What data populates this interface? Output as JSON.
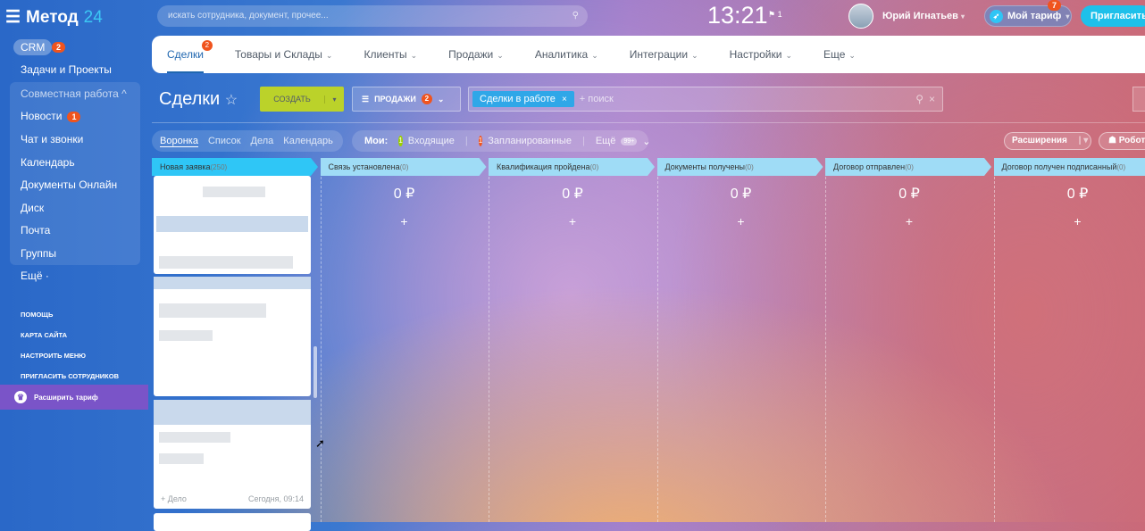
{
  "app": {
    "logo_name": "Метод",
    "logo_num": "24"
  },
  "sidebar": {
    "crm": "CRM",
    "crm_badge": "2",
    "tasks": "Задачи и Проекты",
    "group": "Совместная работа ^",
    "news": "Новости",
    "news_badge": "1",
    "chat": "Чат и звонки",
    "calendar": "Календарь",
    "docs": "Документы Онлайн",
    "disk": "Диск",
    "mail": "Почта",
    "groups": "Группы",
    "more": "Ещё ·",
    "help": "Помощь",
    "sitemap": "Карта сайта",
    "setup_menu": "Настроить меню",
    "invite_staff": "Пригласить сотрудников",
    "upgrade": "Расширить тариф"
  },
  "header": {
    "search_placeholder": "искать сотрудника, документ, прочее...",
    "time": "13:21",
    "flag_count": "1",
    "user": "Юрий Игнатьев",
    "tariff": "Мой тариф",
    "tariff_badge": "7",
    "invite": "Пригласить"
  },
  "menu": {
    "items": [
      {
        "label": "Сделки",
        "badge": "2"
      },
      {
        "label": "Товары и Склады"
      },
      {
        "label": "Клиенты"
      },
      {
        "label": "Продажи"
      },
      {
        "label": "Аналитика"
      },
      {
        "label": "Интеграции"
      },
      {
        "label": "Настройки"
      },
      {
        "label": "Еще"
      }
    ]
  },
  "toolbar": {
    "title": "Сделки",
    "create": "СОЗДАТЬ",
    "sales": "ПРОДАЖИ",
    "sales_badge": "2",
    "filter_chip": "Сделки в работе",
    "filter_placeholder": "+ поиск"
  },
  "views": {
    "tabs": [
      "Воронка",
      "Список",
      "Дела",
      "Календарь"
    ],
    "my": "Мои:",
    "incoming_count": "1",
    "incoming": "Входящие",
    "planned_count": "1",
    "planned": "Запланированные",
    "more": "Ещё",
    "more_count": "99+",
    "extensions": "Расширения",
    "robots": "Роботы"
  },
  "stages": [
    {
      "name": "Новая заявка",
      "count": "(250)",
      "color": "#2fc6f6",
      "sum": ""
    },
    {
      "name": "Связь установлена",
      "count": "(0)",
      "color": "#9fdcf6",
      "sum": "0 ₽"
    },
    {
      "name": "Квалификация пройдена",
      "count": "(0)",
      "color": "#9fdcf6",
      "sum": "0 ₽"
    },
    {
      "name": "Документы получены",
      "count": "(0)",
      "color": "#9fdcf6",
      "sum": "0 ₽"
    },
    {
      "name": "Договор отправлен",
      "count": "(0)",
      "color": "#9fdcf6",
      "sum": "0 ₽"
    },
    {
      "name": "Договор получен подписанный",
      "count": "(0)",
      "color": "#9fdcf6",
      "sum": "0 ₽"
    }
  ],
  "card": {
    "add_activity": "+ Дело",
    "date": "Сегодня, 09:14"
  },
  "plus": "+"
}
